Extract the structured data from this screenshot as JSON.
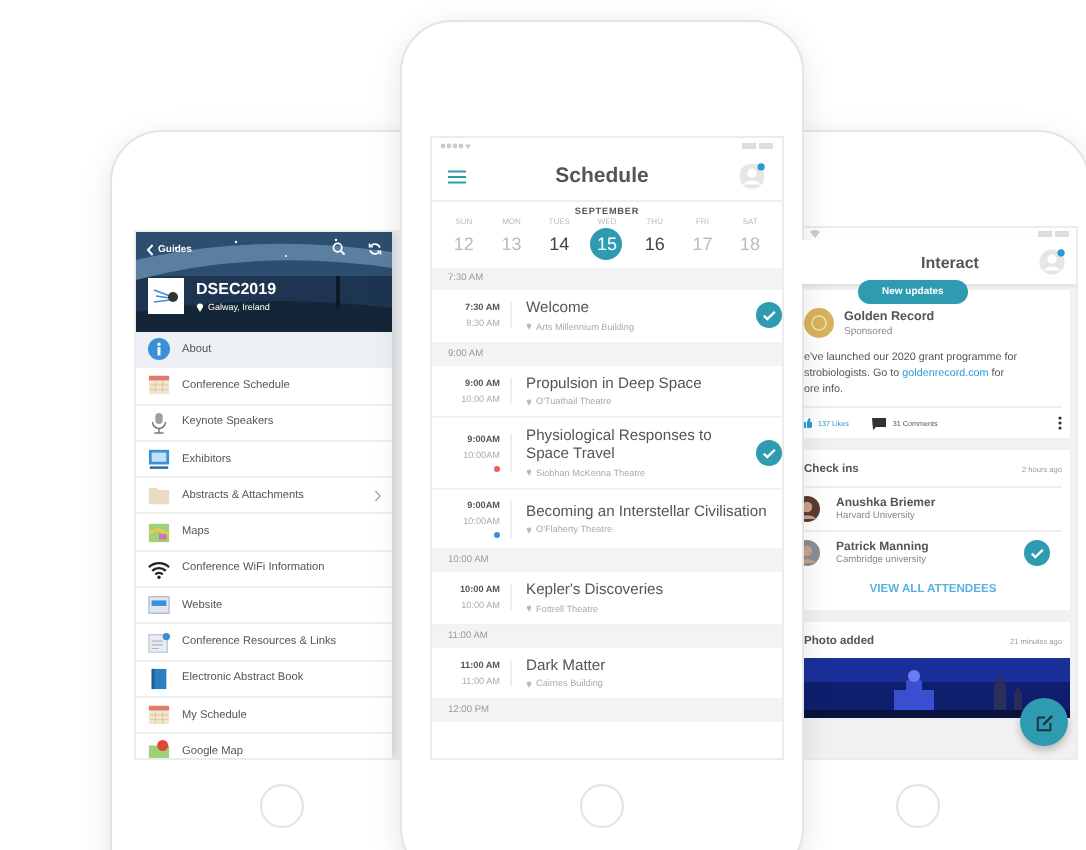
{
  "guides_phone": {
    "back_label": "Guides",
    "event_name": "DSEC2019",
    "event_location": "Galway, Ireland",
    "menu": [
      {
        "label": "About",
        "kind": "info",
        "selected": true,
        "has_submenu": false
      },
      {
        "label": "Conference Schedule",
        "kind": "calendar",
        "selected": false,
        "has_submenu": false
      },
      {
        "label": "Keynote Speakers",
        "kind": "microphone",
        "selected": false,
        "has_submenu": false
      },
      {
        "label": "Exhibitors",
        "kind": "monitor",
        "selected": false,
        "has_submenu": false
      },
      {
        "label": "Abstracts & Attachments",
        "kind": "folder",
        "selected": false,
        "has_submenu": true
      },
      {
        "label": "Maps",
        "kind": "map",
        "selected": false,
        "has_submenu": false
      },
      {
        "label": "Conference WiFi Information",
        "kind": "wifi",
        "selected": false,
        "has_submenu": false
      },
      {
        "label": "Website",
        "kind": "browser",
        "selected": false,
        "has_submenu": false
      },
      {
        "label": "Conference Resources & Links",
        "kind": "document",
        "selected": false,
        "has_submenu": false
      },
      {
        "label": "Electronic Abstract Book",
        "kind": "book",
        "selected": false,
        "has_submenu": false
      },
      {
        "label": "My Schedule",
        "kind": "calendar",
        "selected": false,
        "has_submenu": false
      },
      {
        "label": "Google Map",
        "kind": "pin",
        "selected": false,
        "has_submenu": false
      }
    ]
  },
  "schedule_phone": {
    "title": "Schedule",
    "month": "SEPTEMBER",
    "days": [
      {
        "weekday": "SUN",
        "date": "12",
        "muted": true,
        "selected": false
      },
      {
        "weekday": "MON",
        "date": "13",
        "muted": true,
        "selected": false
      },
      {
        "weekday": "TUES",
        "date": "14",
        "muted": false,
        "selected": false
      },
      {
        "weekday": "WED",
        "date": "15",
        "muted": false,
        "selected": true
      },
      {
        "weekday": "THU",
        "date": "16",
        "muted": false,
        "selected": false
      },
      {
        "weekday": "FRI",
        "date": "17",
        "muted": true,
        "selected": false
      },
      {
        "weekday": "SAT",
        "date": "18",
        "muted": true,
        "selected": false
      }
    ],
    "agenda": [
      {
        "kind": "header",
        "time": "7:30 AM"
      },
      {
        "kind": "session",
        "start": "7:30 AM",
        "end": "8:30 AM",
        "title": "Welcome",
        "location": "Arts Millennium Building",
        "checked": true
      },
      {
        "kind": "header",
        "time": "9:00 AM"
      },
      {
        "kind": "session",
        "start": "9:00 AM",
        "end": "10:00 AM",
        "title": "Propulsion in Deep Space",
        "location": "O'Tuathail Theatre",
        "checked": false
      },
      {
        "kind": "session",
        "start": "9:00AM",
        "end": "10:00AM",
        "title": "Physiological Responses to Space Travel",
        "location": "Siobhan McKenna Theatre",
        "checked": true,
        "color": "#e8605c"
      },
      {
        "kind": "session",
        "start": "9:00AM",
        "end": "10:00AM",
        "title": "Becoming an Interstellar Civilisation",
        "location": "O'Flaherty Theatre",
        "checked": false,
        "color": "#3a8fd8"
      },
      {
        "kind": "header",
        "time": "10:00 AM"
      },
      {
        "kind": "session",
        "start": "10:00 AM",
        "end": "10:00 AM",
        "title": "Kepler's Discoveries",
        "location": "Fottrell Theatre",
        "checked": false
      },
      {
        "kind": "header",
        "time": "11:00 AM"
      },
      {
        "kind": "session",
        "start": "11:00 AM",
        "end": "11:00 AM",
        "title": "Dark Matter",
        "location": "Cairnes Building",
        "checked": false
      },
      {
        "kind": "header",
        "time": "12:00 PM"
      }
    ]
  },
  "interact_phone": {
    "title": "Interact",
    "new_updates": "New updates",
    "post": {
      "author": "Golden Record",
      "subtitle": "Sponsored",
      "body_start": "e've launched our 2020 grant programme for\nstrobiologists. Go to",
      "link": "goldenrecord.com",
      "body_end": "for\nore info.",
      "likes": "137 Likes",
      "comments": "31 Comments"
    },
    "check_ins": {
      "title": "Check ins",
      "time": "2 hours ago",
      "people": [
        {
          "name": "Anushka Briemer",
          "affiliation": "Harvard University",
          "checked": false
        },
        {
          "name": "Patrick Manning",
          "affiliation": "Cambridge university",
          "checked": true
        }
      ],
      "action": "VIEW ALL ATTENDEES"
    },
    "photo_post": {
      "title": "Photo added",
      "time": "21 minutes ago"
    }
  }
}
